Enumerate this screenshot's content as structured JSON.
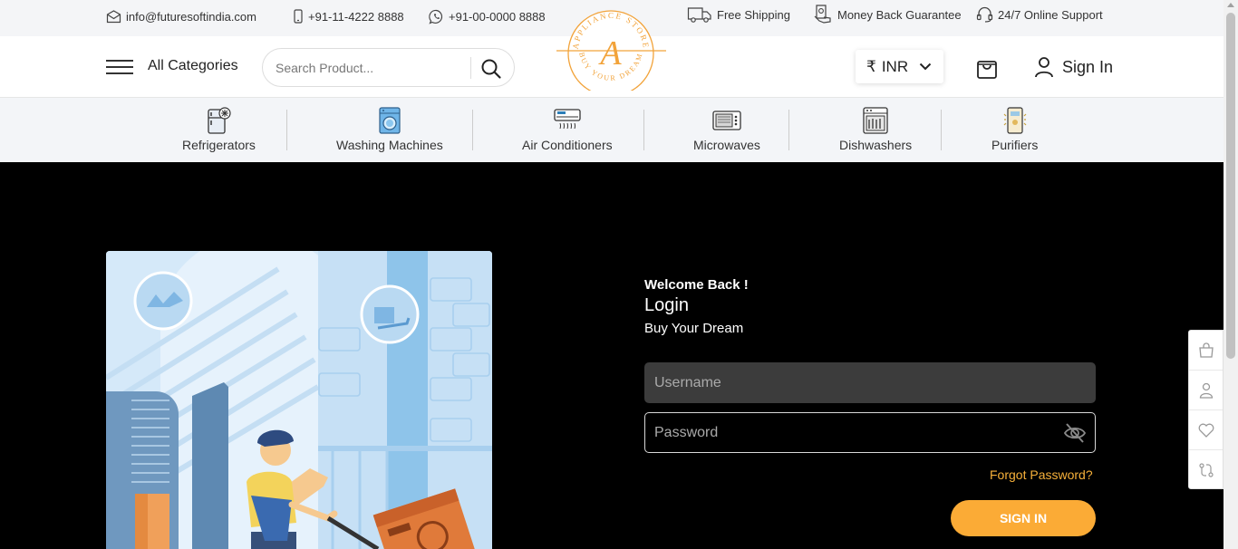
{
  "topbar": {
    "email": "info@futuresoftindia.com",
    "phone": "+91-11-4222 8888",
    "whatsapp": "+91-00-0000 8888",
    "shipping": "Free Shipping",
    "guarantee": "Money Back Guarantee",
    "support": "24/7 Online Support"
  },
  "header": {
    "categories_label": "All Categories",
    "search_placeholder": "Search Product...",
    "logo": {
      "top_text": "APPLIANCE STORE",
      "letter": "A",
      "bottom_text": "BUY YOUR DREAM"
    },
    "currency_symbol": "₹",
    "currency": "INR",
    "signin_label": "Sign In"
  },
  "categories": [
    {
      "label": "Refrigerators",
      "icon": "refrigerator-icon"
    },
    {
      "label": "Washing Machines",
      "icon": "washing-machine-icon"
    },
    {
      "label": "Air Conditioners",
      "icon": "air-conditioner-icon"
    },
    {
      "label": "Microwaves",
      "icon": "microwave-icon"
    },
    {
      "label": "Dishwashers",
      "icon": "dishwasher-icon"
    },
    {
      "label": "Purifiers",
      "icon": "purifier-icon"
    }
  ],
  "login": {
    "welcome": "Welcome Back !",
    "title": "Login",
    "tagline": "Buy Your Dream",
    "username_placeholder": "Username",
    "password_placeholder": "Password",
    "forgot": "Forgot Password?",
    "submit": "SIGN IN"
  },
  "sidebar_icons": [
    "bag-icon",
    "user-icon",
    "heart-icon",
    "compare-icon"
  ],
  "colors": {
    "accent": "#fbab36",
    "logo": "#f2a33a",
    "page_bg": "#000000",
    "topbar_bg": "#f4f5f7"
  }
}
